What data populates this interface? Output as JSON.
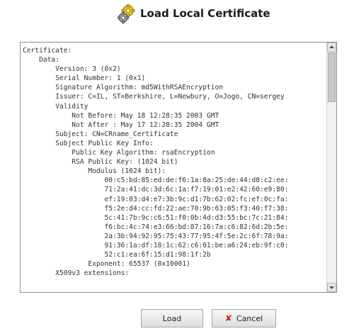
{
  "header": {
    "title": "Load Local Certificate",
    "icon": "gears-icon"
  },
  "certificate_text": [
    "Certificate:",
    "    Data:",
    "        Version: 3 (0x2)",
    "        Serial Number: 1 (0x1)",
    "        Signature Algorithm: md5WithRSAEncryption",
    "        Issuer: C=IL, ST=Berkshire, L=Newbury, O=Jogo, CN=sergey",
    "        Validity",
    "            Not Before: May 18 12:28:35 2003 GMT",
    "            Not After : May 17 12:28:35 2004 GMT",
    "        Subject: CN=CRname_Certificate",
    "        Subject Public Key Info:",
    "            Public Key Algorithm: rsaEncryption",
    "            RSA Public Key: (1024 bit)",
    "                Modulus (1024 bit):",
    "                    00:c5:bd:85:ed:de:f6:1a:8a:25:de:44:d8:c2:ee:",
    "                    71:2a:41:dc:3d:6c:1a:f7:19:01:e2:42:60:e9:80:",
    "                    ef:19:03:d4:e7:3b:9c:d1:7b:62:02:fc:ef:0c:fa:",
    "                    f5:2e:d4:cc:fd:22:ae:70:9b:63:05:f3:40:f7:38:",
    "                    5c:41:7b:9c:c6:51:f0:0b:4d:d3:55:bc:7c:21:84:",
    "                    f6:bc:4c:74:e3:66:bd:87:16:7a:c6:82:6d:2b:5e:",
    "                    2a:3b:94:92:95:75:43:77:95:4f:5e:2c:6f:78:9a:",
    "                    91:36:1a:df:18:1c:62:c6:01:be:a6:24:eb:9f:c0:",
    "                    52:c1:ea:6f:15:d1:98:1f:2b",
    "                Exponent: 65537 (0x10001)",
    "        X509v3 extensions:"
  ],
  "buttons": {
    "load": "Load",
    "cancel": "Cancel"
  }
}
